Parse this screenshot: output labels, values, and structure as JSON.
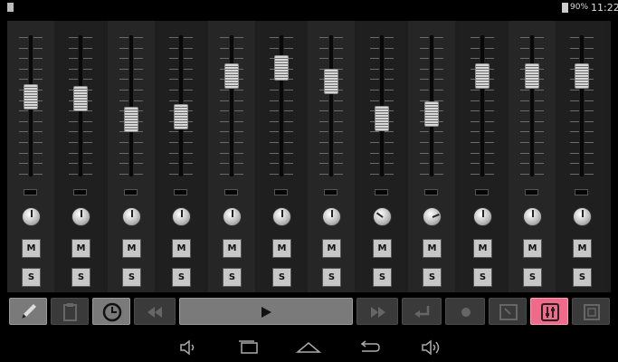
{
  "status_bar": {
    "battery_percent": "90%",
    "time": "11:22",
    "icons": [
      "sim-icon",
      "battery-icon"
    ]
  },
  "mixer": {
    "channels": [
      {
        "index": 1,
        "fader_level": 0.58,
        "pan": 0,
        "mute_label": "M",
        "solo_label": "S"
      },
      {
        "index": 2,
        "fader_level": 0.56,
        "pan": 0,
        "mute_label": "M",
        "solo_label": "S"
      },
      {
        "index": 3,
        "fader_level": 0.38,
        "pan": 0,
        "mute_label": "M",
        "solo_label": "S"
      },
      {
        "index": 4,
        "fader_level": 0.41,
        "pan": 0,
        "mute_label": "M",
        "solo_label": "S"
      },
      {
        "index": 5,
        "fader_level": 0.76,
        "pan": 0,
        "mute_label": "M",
        "solo_label": "S"
      },
      {
        "index": 6,
        "fader_level": 0.83,
        "pan": 0,
        "mute_label": "M",
        "solo_label": "S"
      },
      {
        "index": 7,
        "fader_level": 0.71,
        "pan": 0,
        "mute_label": "M",
        "solo_label": "S"
      },
      {
        "index": 8,
        "fader_level": 0.39,
        "pan": -0.4,
        "mute_label": "M",
        "solo_label": "S"
      },
      {
        "index": 9,
        "fader_level": 0.43,
        "pan": 0.5,
        "mute_label": "M",
        "solo_label": "S"
      },
      {
        "index": 10,
        "fader_level": 0.76,
        "pan": 0,
        "mute_label": "M",
        "solo_label": "S"
      },
      {
        "index": 11,
        "fader_level": 0.76,
        "pan": 0,
        "mute_label": "M",
        "solo_label": "S"
      },
      {
        "index": 12,
        "fader_level": 0.76,
        "pan": 0,
        "mute_label": "M",
        "solo_label": "S"
      }
    ]
  },
  "toolbar": {
    "buttons": [
      {
        "name": "pencil-button",
        "icon": "pencil-icon",
        "enabled": true,
        "active": false
      },
      {
        "name": "clipboard-button",
        "icon": "clipboard-icon",
        "enabled": false,
        "active": false
      },
      {
        "name": "clock-button",
        "icon": "clock-icon",
        "enabled": true,
        "active": false
      },
      {
        "name": "rewind-button",
        "icon": "rewind-icon",
        "enabled": false,
        "active": false
      },
      {
        "name": "play-button",
        "icon": "play-icon",
        "enabled": true,
        "active": false
      },
      {
        "name": "fast-forward-button",
        "icon": "fast-forward-icon",
        "enabled": false,
        "active": false
      },
      {
        "name": "loop-button",
        "icon": "loop-icon",
        "enabled": false,
        "active": false
      },
      {
        "name": "record-button",
        "icon": "record-icon",
        "enabled": false,
        "active": false
      },
      {
        "name": "piano-roll-button",
        "icon": "piano-roll-icon",
        "enabled": false,
        "active": false
      },
      {
        "name": "mixer-button",
        "icon": "mixer-icon",
        "enabled": true,
        "active": true
      },
      {
        "name": "settings-button",
        "icon": "panel-icon",
        "enabled": false,
        "active": false
      }
    ],
    "active_color": "#f06b8a"
  },
  "nav_bar": {
    "icons": [
      "volume-down-icon",
      "recent-apps-icon",
      "home-icon",
      "back-icon",
      "volume-up-icon"
    ]
  }
}
